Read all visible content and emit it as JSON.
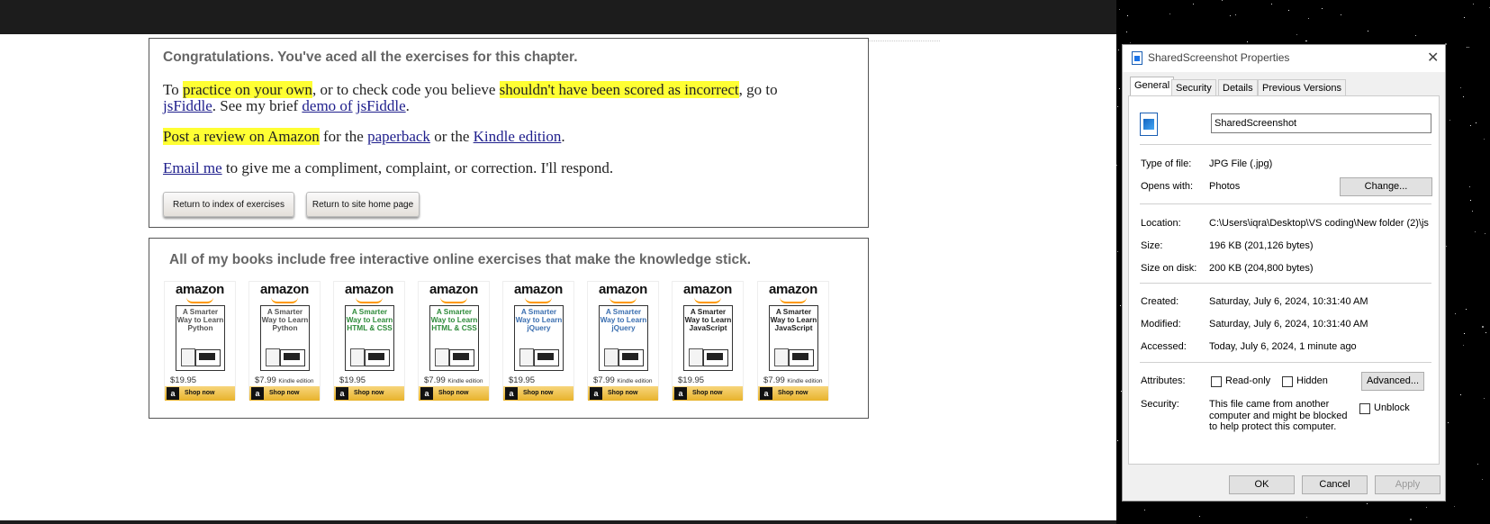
{
  "chapter": {
    "congrats": "Congratulations. You've aced all the exercises for this chapter.",
    "p1": {
      "a": "To ",
      "b": "practice on your own",
      "c": ", or to check code you believe ",
      "d": "shouldn't have been scored as incorrect",
      "e": ", go to",
      "f": "jsFiddle",
      "g": ". See my brief ",
      "h": "demo of",
      "i": " ",
      "j": "jsFiddle",
      "k": "."
    },
    "p2": {
      "a": "Post a review on Amazon",
      "b": " for the ",
      "c": "paperback",
      "d": " or the ",
      "e": "Kindle edition",
      "f": "."
    },
    "p3": {
      "a": "Email me",
      "b": " to give me a compliment, complaint, or correction. I'll respond."
    },
    "btn_index": "Return to index of exercises",
    "btn_home": "Return to site home page"
  },
  "books": {
    "heading": "All of my books include free interactive online exercises that make the knowledge stick.",
    "logo": "amazon",
    "shop": "Shop now",
    "items": [
      {
        "title": "A Smarter Way to Learn Python",
        "price": "$19.95",
        "edition": "",
        "color": "#555"
      },
      {
        "title": "A Smarter Way to Learn Python",
        "price": "$7.99",
        "edition": "Kindle edition",
        "color": "#555"
      },
      {
        "title": "A Smarter Way to Learn HTML & CSS",
        "price": "$19.95",
        "edition": "",
        "color": "#2e8b3a"
      },
      {
        "title": "A Smarter Way to Learn HTML & CSS",
        "price": "$7.99",
        "edition": "Kindle edition",
        "color": "#2e8b3a"
      },
      {
        "title": "A Smarter Way to Learn jQuery",
        "price": "$19.95",
        "edition": "",
        "color": "#3b6fb0"
      },
      {
        "title": "A Smarter Way to Learn jQuery",
        "price": "$7.99",
        "edition": "Kindle edition",
        "color": "#3b6fb0"
      },
      {
        "title": "A Smarter Way to Learn JavaScript",
        "price": "$19.95",
        "edition": "",
        "color": "#222"
      },
      {
        "title": "A Smarter Way to Learn JavaScript",
        "price": "$7.99",
        "edition": "Kindle edition",
        "color": "#222"
      }
    ]
  },
  "dialog": {
    "title": "SharedScreenshot Properties",
    "tabs": [
      "General",
      "Security",
      "Details",
      "Previous Versions"
    ],
    "filename": "SharedScreenshot",
    "type_label": "Type of file:",
    "type_value": "JPG File (.jpg)",
    "opens_label": "Opens with:",
    "opens_value": "Photos",
    "change": "Change...",
    "location_label": "Location:",
    "location_value": "C:\\Users\\iqra\\Desktop\\VS coding\\New folder (2)\\js",
    "size_label": "Size:",
    "size_value": "196 KB (201,126 bytes)",
    "disk_label": "Size on disk:",
    "disk_value": "200 KB (204,800 bytes)",
    "created_label": "Created:",
    "created_value": "Saturday, July 6, 2024, 10:31:40 AM",
    "modified_label": "Modified:",
    "modified_value": "Saturday, July 6, 2024, 10:31:40 AM",
    "accessed_label": "Accessed:",
    "accessed_value": "Today, July 6, 2024, 1 minute ago",
    "attr_label": "Attributes:",
    "readonly": "Read-only",
    "hidden": "Hidden",
    "advanced": "Advanced...",
    "security_label": "Security:",
    "security_text": "This file came from another computer and might be blocked to help protect this computer.",
    "unblock": "Unblock",
    "ok": "OK",
    "cancel": "Cancel",
    "apply": "Apply"
  }
}
